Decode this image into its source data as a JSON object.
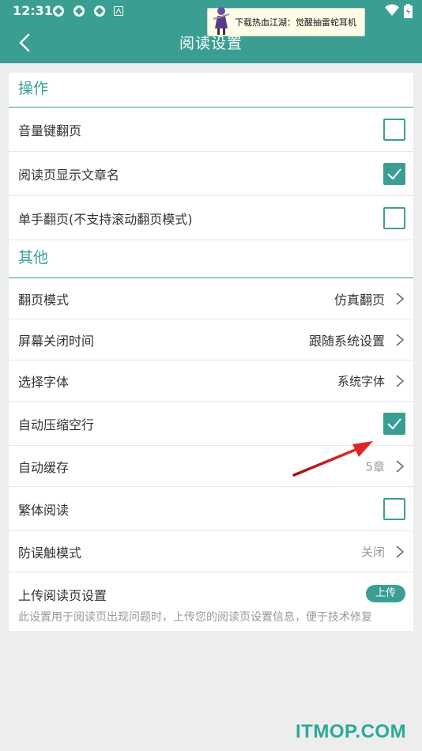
{
  "status_bar": {
    "time": "12:31"
  },
  "app_bar": {
    "title": "阅读设置"
  },
  "ad_banner": {
    "text": "下载热血江湖：觉醒抽雷蛇耳机"
  },
  "sections": {
    "operation": {
      "title": "操作",
      "items": [
        {
          "label": "音量键翻页",
          "checked": false
        },
        {
          "label": "阅读页显示文章名",
          "checked": true
        },
        {
          "label": "单手翻页(不支持滚动翻页模式)",
          "checked": false
        }
      ]
    },
    "other": {
      "title": "其他",
      "page_mode": {
        "label": "翻页模式",
        "value": "仿真翻页"
      },
      "screen_off": {
        "label": "屏幕关闭时间",
        "value": "跟随系统设置"
      },
      "font": {
        "label": "选择字体",
        "value": "系统字体"
      },
      "compress_blank": {
        "label": "自动压缩空行",
        "checked": true
      },
      "auto_cache": {
        "label": "自动缓存",
        "value": "5章"
      },
      "traditional": {
        "label": "繁体阅读",
        "checked": false
      },
      "mistouch": {
        "label": "防误触模式",
        "value": "关闭"
      },
      "upload": {
        "label": "上传阅读页设置",
        "button": "上传",
        "description": "此设置用于阅读页出现问题时，上传您的阅读页设置信息，便于技术修复"
      }
    }
  },
  "watermark": "ITMOP.COM",
  "colors": {
    "accent": "#3a9f92",
    "arrow": "#d42020"
  }
}
